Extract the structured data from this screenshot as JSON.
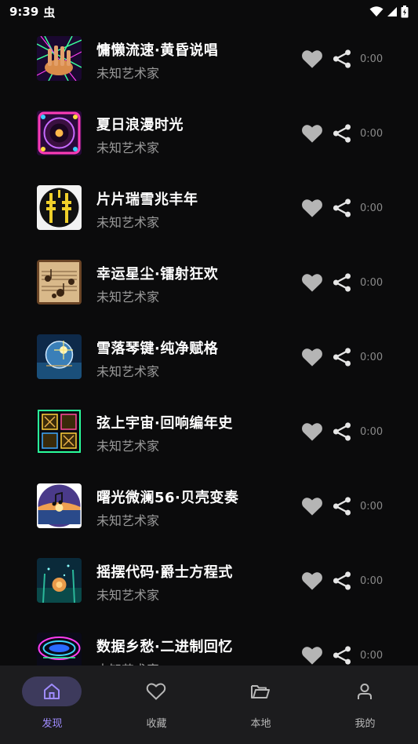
{
  "status_bar": {
    "time": "9:39",
    "app_icon": "虫"
  },
  "songs": [
    {
      "title": "慵懒流速·黄昏说唱",
      "artist": "未知艺术家",
      "duration": "0:00"
    },
    {
      "title": "夏日浪漫时光",
      "artist": "未知艺术家",
      "duration": "0:00"
    },
    {
      "title": "片片瑞雪兆丰年",
      "artist": "未知艺术家",
      "duration": "0:00"
    },
    {
      "title": "幸运星尘·镭射狂欢",
      "artist": "未知艺术家",
      "duration": "0:00"
    },
    {
      "title": "雪落琴键·纯净赋格",
      "artist": "未知艺术家",
      "duration": "0:00"
    },
    {
      "title": "弦上宇宙·回响编年史",
      "artist": "未知艺术家",
      "duration": "0:00"
    },
    {
      "title": "曙光微澜56·贝壳变奏",
      "artist": "未知艺术家",
      "duration": "0:00"
    },
    {
      "title": "摇摆代码·爵士方程式",
      "artist": "未知艺术家",
      "duration": "0:00"
    },
    {
      "title": "数据乡愁·二进制回忆",
      "artist": "未知艺术家",
      "duration": "0:00"
    }
  ],
  "bottom_nav": {
    "discover": "发现",
    "favorites": "收藏",
    "local": "本地",
    "mine": "我的"
  },
  "colors": {
    "background": "#0b0b0c",
    "nav_background": "#1c1c1e",
    "active_accent": "#a08cff",
    "icon_gray": "#b5b5b5"
  }
}
